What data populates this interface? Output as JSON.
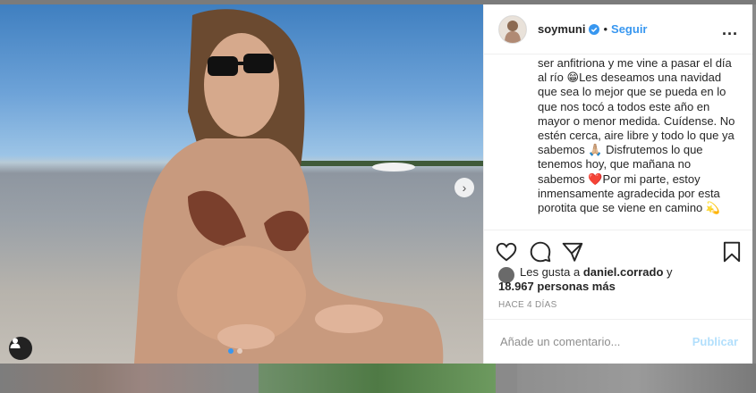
{
  "post": {
    "username": "soymuni",
    "bullet": "•",
    "follow_label": "Seguir",
    "more_label": "...",
    "caption": "ser anfitriona y me vine a pasar el día al río 😁Les deseamos una navidad que sea lo mejor que se pueda en lo que nos tocó a todos este año en mayor o menor medida. Cuídense. No estén cerca, aire libre y todo lo que ya sabemos 🙏🏼 Disfrutemos lo que tenemos hoy, que mañana no sabemos ❤️Por mi parte, estoy inmensamente agradecida por esta porotita que se viene en camino 💫",
    "likes_prefix": "Les gusta a ",
    "likes_user": "daniel.corrado",
    "likes_suffix": " y",
    "likes_count": "18.967 personas más",
    "timestamp": "HACE 4 DÍAS",
    "comment_placeholder": "Añade un comentario...",
    "publish_label": "Publicar",
    "next_label": "›"
  },
  "icons": {
    "verified": "verified-badge-icon",
    "like": "heart-icon",
    "comment": "comment-bubble-icon",
    "share": "paper-plane-icon",
    "save": "bookmark-icon",
    "next": "chevron-right-icon",
    "tag": "user-tag-icon"
  },
  "colors": {
    "accent": "#3897f0",
    "publish_disabled": "#b2dffc",
    "muted": "#8e8e8e",
    "text": "#262626"
  }
}
